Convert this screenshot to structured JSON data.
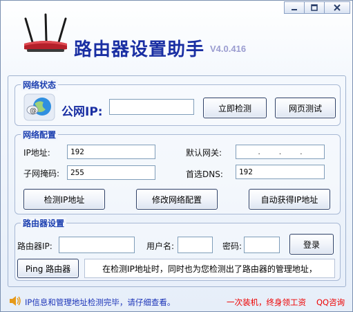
{
  "app": {
    "title": "路由器设置助手",
    "version": "V4.0.416"
  },
  "network_status": {
    "group_label": "网络状态",
    "public_ip_label": "公网IP:",
    "public_ip_value": "",
    "check_now_button": "立即检测",
    "web_test_button": "网页测试"
  },
  "network_config": {
    "group_label": "网络配置",
    "ip_label": "IP地址:",
    "ip_value": "192",
    "gateway_label": "默认网关:",
    "gateway_dots": [
      ".",
      ".",
      "."
    ],
    "subnet_label": "子网掩码:",
    "subnet_value": "255",
    "dns_label": "首选DNS:",
    "dns_value": "192",
    "detect_ip_button": "检测IP地址",
    "modify_config_button": "修改网络配置",
    "auto_ip_button": "自动获得IP地址"
  },
  "router_settings": {
    "group_label": "路由器设置",
    "router_ip_label": "路由器IP:",
    "router_ip_value": "",
    "username_label": "用户名:",
    "username_value": "",
    "password_label": "密码:",
    "password_value": "",
    "login_button": "登录",
    "ping_button": "Ping 路由器",
    "note": "在检测IP地址时，同时也为您检测出了路由器的管理地址，"
  },
  "status_bar": {
    "message": "IP信息和管理地址检测完毕，请仔细查看。",
    "promo": "一次装机，终身领工资",
    "qq": "QQ咨询"
  },
  "colors": {
    "title_blue": "#1a2fa3",
    "group_label_blue": "#1c3fb0",
    "status_blue": "#1c34b8",
    "promo_red": "#e00000"
  },
  "icons": [
    "router-icon",
    "network-icon",
    "speaker-icon",
    "minimize-icon",
    "maximize-icon",
    "close-icon"
  ]
}
